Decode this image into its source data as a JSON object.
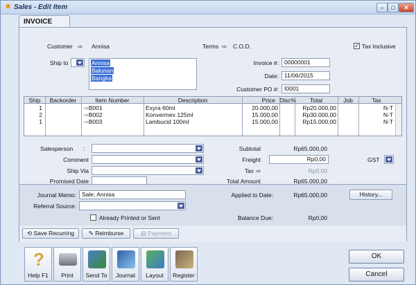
{
  "window": {
    "title": "Sales - Edit Item",
    "minimize": "–",
    "maximize": "□",
    "close": "✕"
  },
  "tab": {
    "label": "INVOICE"
  },
  "header": {
    "customer_label": "Customer",
    "customer_value": "Annisa",
    "terms_label": "Terms",
    "terms_value": "C.O.D.",
    "tax_inclusive_label": "Tax Inclusive",
    "tax_inclusive_checked": true,
    "ship_to_label": "Ship to",
    "ship_to_lines": [
      "Annisa",
      "Balunan",
      "Bangka"
    ],
    "invoice_no_label": "Invoice #:",
    "invoice_no_value": "00000001",
    "date_label": "Date:",
    "date_value": "11/06/2015",
    "customer_po_label": "Customer PO #:",
    "customer_po_value": "I0001"
  },
  "grid": {
    "columns": [
      "Ship",
      "Backorder",
      "Item Number",
      "Description",
      "Price",
      "Disc%",
      "Total",
      "Job",
      "Tax"
    ],
    "rows": [
      {
        "ship": "1",
        "backorder": "",
        "item": "B001",
        "description": "Exyra 60ml",
        "price": "20.000,00",
        "disc": "",
        "total": "Rp20.000,00",
        "job": "",
        "tax": "N-T"
      },
      {
        "ship": "2",
        "backorder": "",
        "item": "B002",
        "description": "Konvermex 125ml",
        "price": "15.000,00",
        "disc": "",
        "total": "Rp30.000,00",
        "job": "",
        "tax": "N-T"
      },
      {
        "ship": "1",
        "backorder": "",
        "item": "B003",
        "description": "Lambucid 100ml",
        "price": "15.000,00",
        "disc": "",
        "total": "Rp15.000,00",
        "job": "",
        "tax": "N-T"
      }
    ]
  },
  "details": {
    "salesperson_label": "Salesperson",
    "comment_label": "Comment",
    "ship_via_label": "Ship Via",
    "promised_date_label": "Promised Date"
  },
  "totals": {
    "subtotal_label": "Subtotal",
    "subtotal_value": "Rp65.000,00",
    "freight_label": "Freight",
    "freight_value": "Rp0,00",
    "tax_label": "Tax",
    "tax_value": "Rp0,00",
    "total_label": "Total Amount",
    "total_value": "Rp65.000,00",
    "tax_code": "GST"
  },
  "lower": {
    "journal_memo_label": "Journal Memo:",
    "journal_memo_value": "Sale; Annisa",
    "referral_label": "Referral Source:",
    "already_printed_label": "Already Printed or Sent",
    "applied_label": "Applied to Date:",
    "applied_value": "Rp65.000,00",
    "balance_label": "Balance Due:",
    "balance_value": "Rp0,00",
    "history_button": "History..."
  },
  "actions": {
    "save_recurring": "Save Recurring",
    "reimburse": "Reimburse",
    "payment": "Payment"
  },
  "toolbar": {
    "help": "Help F1",
    "print": "Print",
    "send_to": "Send To",
    "journal": "Journal",
    "layout": "Layout",
    "register": "Register"
  },
  "dialog": {
    "ok": "OK",
    "cancel": "Cancel"
  }
}
